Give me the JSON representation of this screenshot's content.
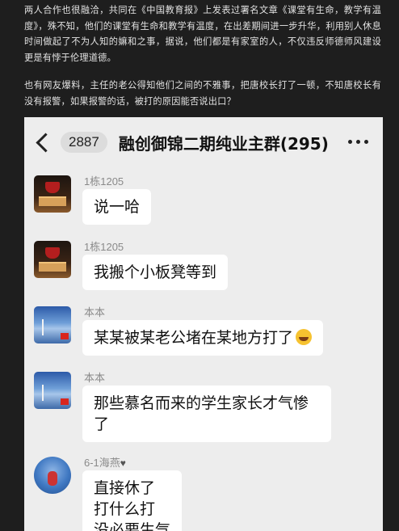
{
  "article": {
    "paragraph1": "两人合作也很融洽，共同在《中国教育报》上发表过署名文章《课堂有生命，教学有温度》，殊不知，他们的课堂有生命和教学有温度，在出差期间进一步升华，利用别人休息时间做起了不为人知的嫲和之事，据说，他们都是有家室的人，不仅违反师德师风建设更是有悖于伦理道德。",
    "paragraph2": "也有网友爆料，主任的老公得知他们之间的不雅事，把唐校长打了一顿，不知唐校长有没有报警，如果报警的话，被打的原因能否说出口？"
  },
  "chat": {
    "unread_count": "2887",
    "group_title": "融创御锦二期纯业主群(295)",
    "messages": [
      {
        "sender": "1栋1205",
        "text": "说一哈",
        "avatar": "trophy-avatar"
      },
      {
        "sender": "1栋1205",
        "text": "我搬个小板凳等到",
        "avatar": "trophy-avatar"
      },
      {
        "sender": "本本",
        "text": "某某被某老公堵在某地方打了",
        "avatar": "sky-avatar",
        "emoji": "laughing-emoji"
      },
      {
        "sender": "本本",
        "text": "那些慕名而来的学生家长才气惨了",
        "avatar": "sky-avatar"
      },
      {
        "sender": "6-1海燕",
        "text_lines": [
          "直接休了",
          "打什么打",
          "没必要生气"
        ],
        "avatar": "round-avatar",
        "sender_icon": "heart-icon"
      }
    ]
  }
}
